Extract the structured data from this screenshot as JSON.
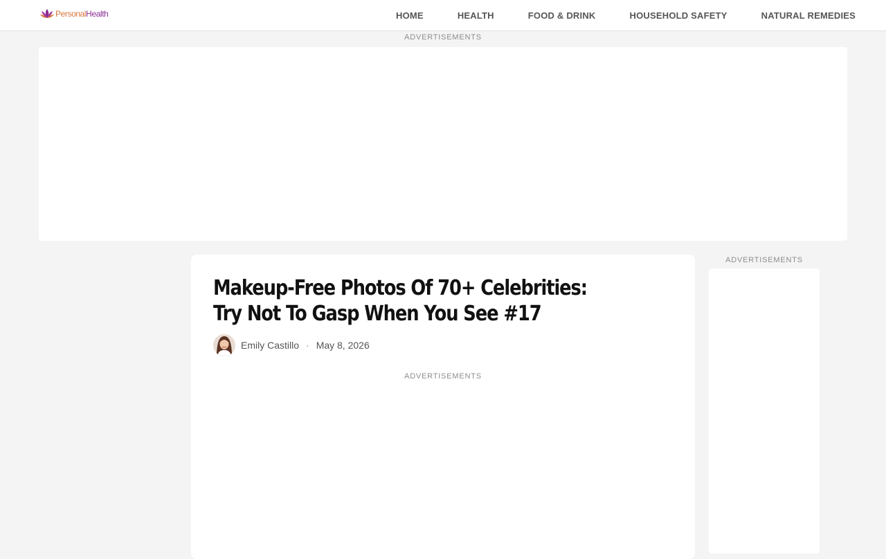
{
  "site": {
    "logo_word1": "Personal",
    "logo_word2": "Health",
    "logo_colors": {
      "primary": "#8b2c93",
      "secondary": "#d9763d"
    }
  },
  "nav": {
    "items": [
      {
        "label": "HOME"
      },
      {
        "label": "HEALTH"
      },
      {
        "label": "FOOD & DRINK"
      },
      {
        "label": "HOUSEHOLD SAFETY"
      },
      {
        "label": "NATURAL REMEDIES"
      }
    ]
  },
  "ads": {
    "top_label": "ADVERTISEMENTS",
    "side_label": "ADVERTISEMENTS",
    "inline_label": "ADVERTISEMENTS"
  },
  "article": {
    "title": "Makeup-Free Photos Of 70+ Celebrities: Try Not To Gasp When You See #17",
    "author": "Emily Castillo",
    "separator": "·",
    "date": "May 8, 2026"
  }
}
